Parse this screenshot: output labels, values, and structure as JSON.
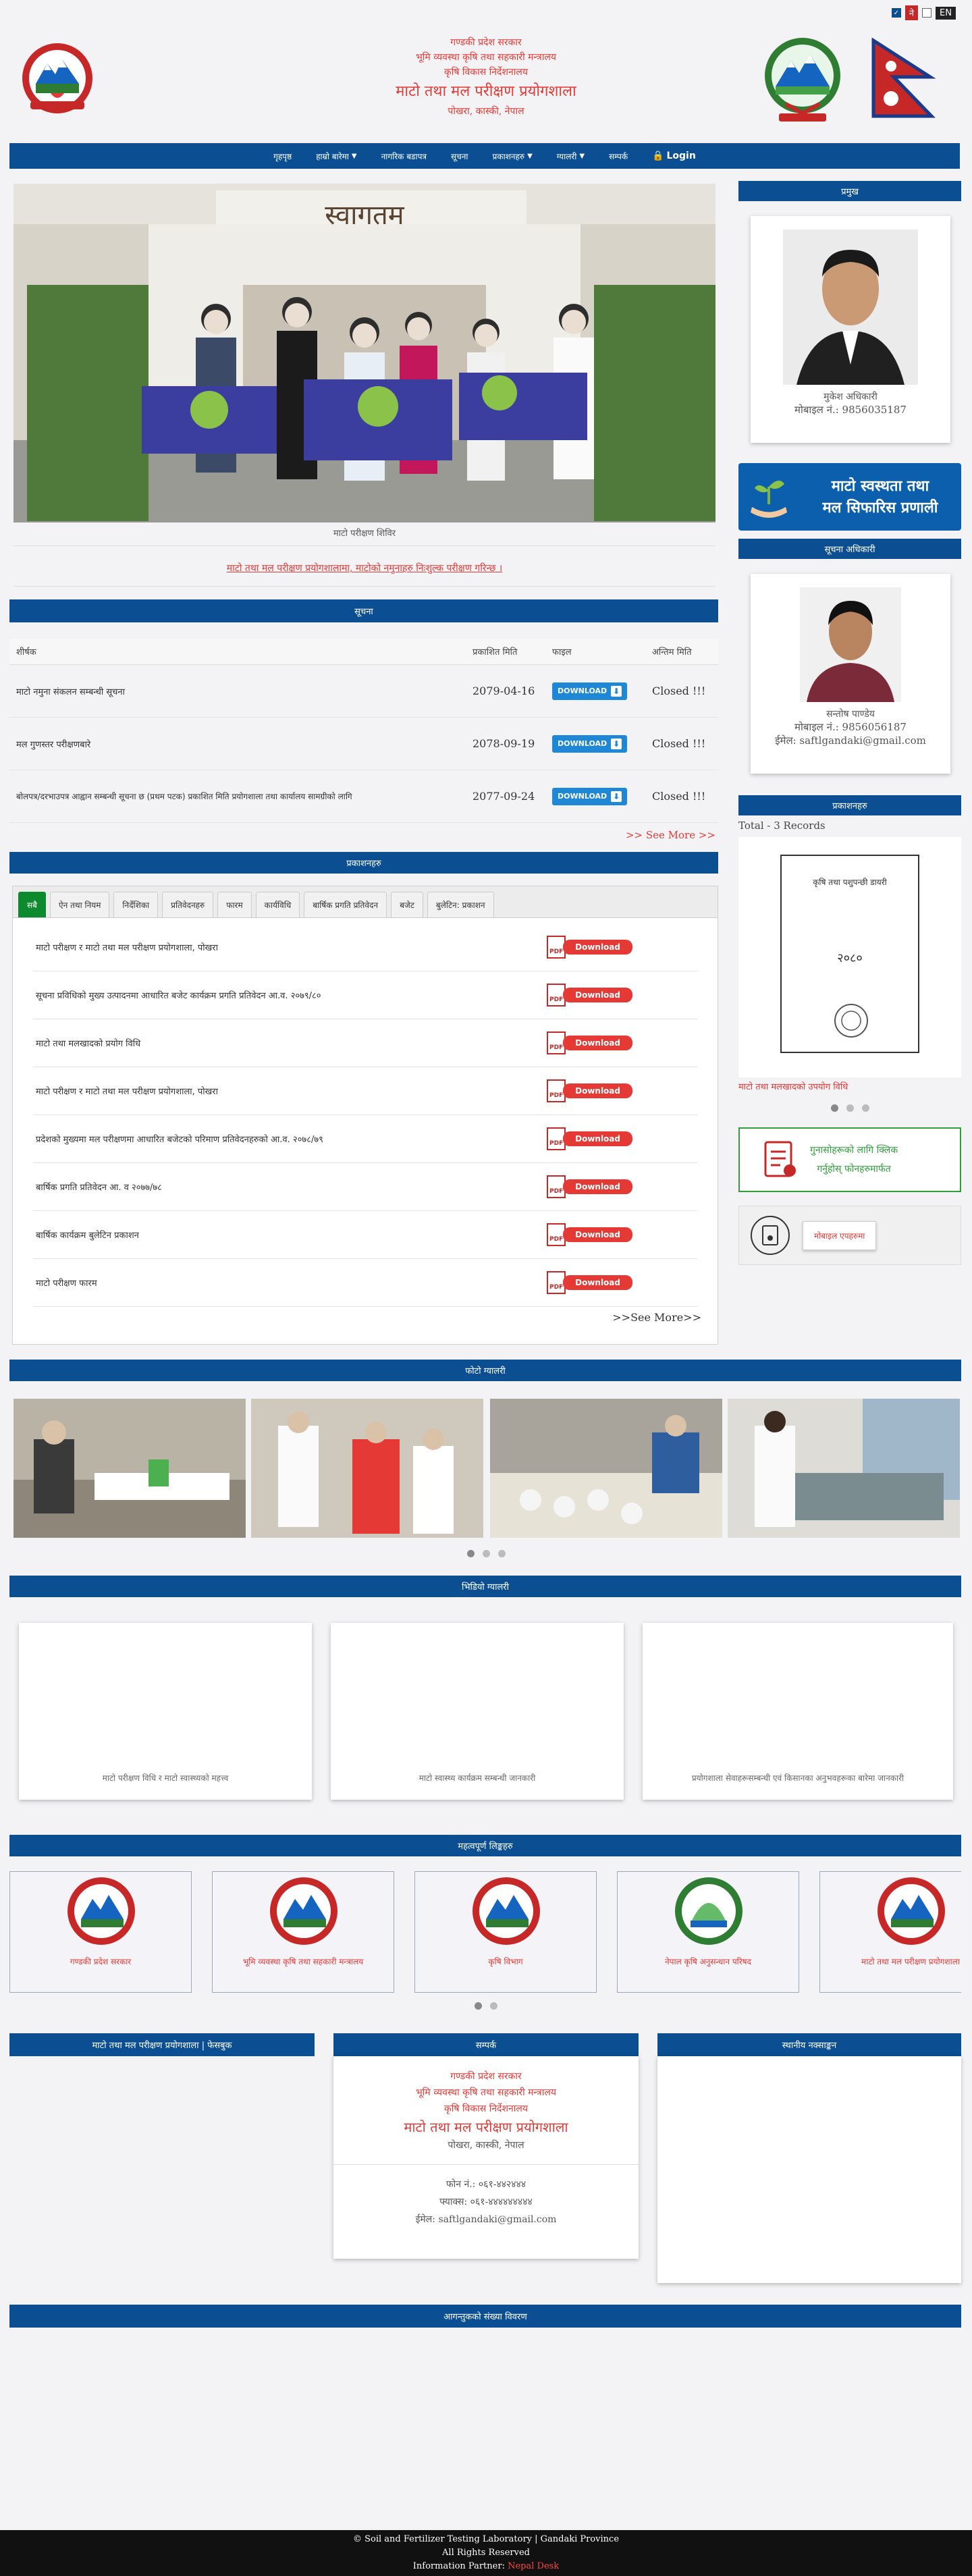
{
  "topbar": {
    "lang_np": "ने",
    "lang_en": "EN"
  },
  "header": {
    "line1": "गण्डकी प्रदेश सरकार",
    "line2": "भूमि व्यवस्था कृषि तथा सहकारी मन्त्रालय",
    "line3": "कृषि विकास निर्देशनालय",
    "title": "माटो तथा मल परीक्षण प्रयोगशाला",
    "address": "पोखरा, कास्की, नेपाल"
  },
  "nav": [
    {
      "label": "गृहपृष्ठ",
      "dropdown": false
    },
    {
      "label": "हाम्रो बारेमा",
      "dropdown": true
    },
    {
      "label": "नागरिक बडापत्र",
      "dropdown": false
    },
    {
      "label": "सूचना",
      "dropdown": false
    },
    {
      "label": "प्रकाशनहरु",
      "dropdown": true
    },
    {
      "label": "ग्यालरी",
      "dropdown": true
    },
    {
      "label": "सम्पर्क",
      "dropdown": false
    },
    {
      "label": "Login",
      "dropdown": false
    }
  ],
  "hero": {
    "caption": "माटो परीक्षण शिविर",
    "sign": "स्वागतम"
  },
  "marquee": "माटो तथा मल परीक्षण प्रयोगशालामा, माटोको नमुनाहरु निःशुल्क परीक्षण गरिन्छ ।",
  "notices": {
    "heading": "सूचना",
    "columns": [
      "शीर्षक",
      "प्रकाशित मिति",
      "फाइल",
      "अन्तिम मिति"
    ],
    "rows": [
      {
        "title": "माटो नमुना संकलन सम्बन्धी सूचना",
        "date": "2079-04-16",
        "file": "DOWNLOAD",
        "status": "Closed !!!"
      },
      {
        "title": "मल गुणस्तर परीक्षणबारे",
        "date": "2078-09-19",
        "file": "DOWNLOAD",
        "status": "Closed !!!"
      },
      {
        "title": "बोलपत्र/दरभाउपत्र आह्वान सम्बन्धी सूचना छ (प्रथम पटक) प्रकाशित मिति प्रयोगशाला तथा कार्यालय सामग्रीको लागि",
        "date": "2077-09-24",
        "file": "DOWNLOAD",
        "status": "Closed !!!"
      }
    ],
    "see_more": ">> See More >>"
  },
  "publications": {
    "heading": "प्रकाशनहरु",
    "tabs": [
      "सबै",
      "ऐन तथा नियम",
      "निर्देशिका",
      "प्रतिवेदनहरु",
      "फारम",
      "कार्यविधि",
      "बार्षिक प्रगति प्रतिवेदन",
      "बजेट",
      "बुलेटिन: प्रकाशन"
    ],
    "docs": [
      "माटो परीक्षण र माटो तथा मल परीक्षण प्रयोगशाला, पोखरा",
      "सूचना प्रविधिको मुख्य उत्पादनमा आधारित बजेट कार्यक्रम प्रगति प्रतिवेदन आ.व. २०७९/८०",
      "माटो तथा मलखादको प्रयोग विधि",
      "माटो परीक्षण र माटो तथा मल परीक्षण प्रयोगशाला, पोखरा",
      "प्रदेशको मुख्यमा मल परीक्षणमा आधारित बजेटको परिमाण प्रतिवेदनहरुको आ.व. २०७८/७९",
      "बार्षिक प्रगति प्रतिवेदन आ. व २०७७/७८",
      "बार्षिक कार्यक्रम बुलेटिन प्रकाशन",
      "माटो परीक्षण फारम"
    ],
    "pdf_label": "Download",
    "pdf_icon": "PDF",
    "see_more": ">>See More>>"
  },
  "gallery": {
    "heading": "फोटो ग्यालरी"
  },
  "videos": {
    "heading": "भिडियो ग्यालरी",
    "items": [
      "माटो परीक्षण विधि र माटो स्वास्थ्यको महत्त्व",
      "माटो स्वास्थ्य कार्यक्रम सम्बन्धी जानकारी",
      "प्रयोगशाला सेवाहरूसम्बन्धी एवं किसानका अनुभवहरूका बारेमा जानकारी"
    ]
  },
  "links": {
    "heading": "महत्वपूर्ण लिङ्कहरु",
    "items": [
      "गण्डकी प्रदेश सरकार",
      "भूमि व्यवस्था कृषि तथा सहकारी मन्त्रालय",
      "कृषि विभाग",
      "नेपाल कृषि अनुसन्धान परिषद",
      "माटो तथा मल परीक्षण प्रयोगशाला"
    ]
  },
  "footer_boxes": {
    "fb": "माटो तथा मल परीक्षण प्रयोगशाला | फेसबुक",
    "contact": "सम्पर्क",
    "map": "स्थानीय नक्साङ्कन",
    "phone": "फोन नं.: ०६१-४४२४४४",
    "fax": "फ्याक्स: ०६१-४४४४४४४४४",
    "email": "ईमेल: saftlgandaki@gmail.com"
  },
  "visitors": {
    "heading": "आगन्तुकको संख्या विवरण"
  },
  "sidebar": {
    "chief_heading": "प्रमुख",
    "chief_name": "मुकेश अधिकारी",
    "chief_phone": "मोबाइल नं.: 9856035187",
    "banner_line1": "माटो स्वस्थता तथा",
    "banner_line2": "मल सिफारिस प्रणाली",
    "info_heading": "सूचना अधिकारी",
    "info_name": "सन्तोष पाण्डेय",
    "info_phone": "मोबाइल नं.: 9856056187",
    "info_email": "ईमेल: saftlgandaki@gmail.com",
    "pub_heading": "प्रकाशनहरु",
    "pub_total": "Total - 3 Records",
    "book_line1": "कृषि तथा पशुपन्छी डायरी",
    "book_year": "२०८०",
    "book_caption": "माटो तथा मलखादको उपयोग विधि",
    "grievance_line1": "गुनासोहरूको लागि क्लिक",
    "grievance_line2": "गर्नुहोस् फोनहरुमार्फत",
    "card_btn": "मोबाइल एपहरुमा"
  },
  "footer": {
    "copyright": "© Soil and Fertilizer Testing Laboratory | Gandaki Province",
    "rights": "All Rights Reserved",
    "partner_label": "Information Partner:",
    "partner_name": "Nepal Desk"
  }
}
